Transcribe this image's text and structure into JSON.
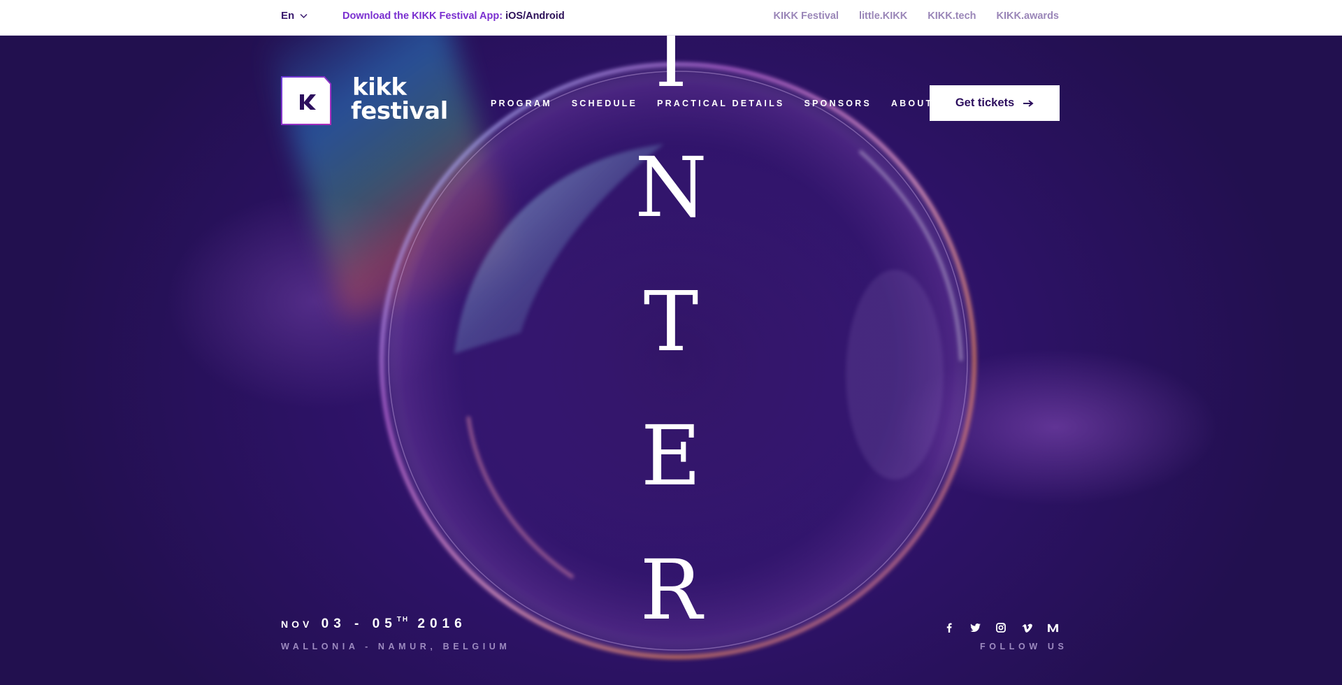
{
  "topbar": {
    "language": "En",
    "app_promo_lead": "Download the KIKK Festival App:",
    "app_promo_platforms": "iOS/Android",
    "site_links": [
      "KIKK Festival",
      "little.KIKK",
      "KIKK.tech",
      "KIKK.awards"
    ]
  },
  "logo": {
    "line1": "kikk",
    "line2": "festival"
  },
  "nav": {
    "items": [
      "PROGRAM",
      "SCHEDULE",
      "PRACTICAL DETAILS",
      "SPONSORS",
      "ABOUT"
    ],
    "tickets_label": "Get tickets"
  },
  "hero": {
    "letters": [
      "I",
      "N",
      "T",
      "E",
      "R"
    ]
  },
  "event": {
    "month": "NOV",
    "days": "03 - 05",
    "days_suffix": "TH",
    "year": "2016",
    "location": "WALLONIA - NAMUR, BELGIUM"
  },
  "social": {
    "icons": [
      "facebook-icon",
      "twitter-icon",
      "instagram-icon",
      "vimeo-icon",
      "medium-icon"
    ],
    "follow_label": "FOLLOW US"
  },
  "colors": {
    "background": "#2b1160",
    "accent": "#7a2fd0",
    "muted_text": "#9d8bc0",
    "link_text": "#9a86b8"
  }
}
